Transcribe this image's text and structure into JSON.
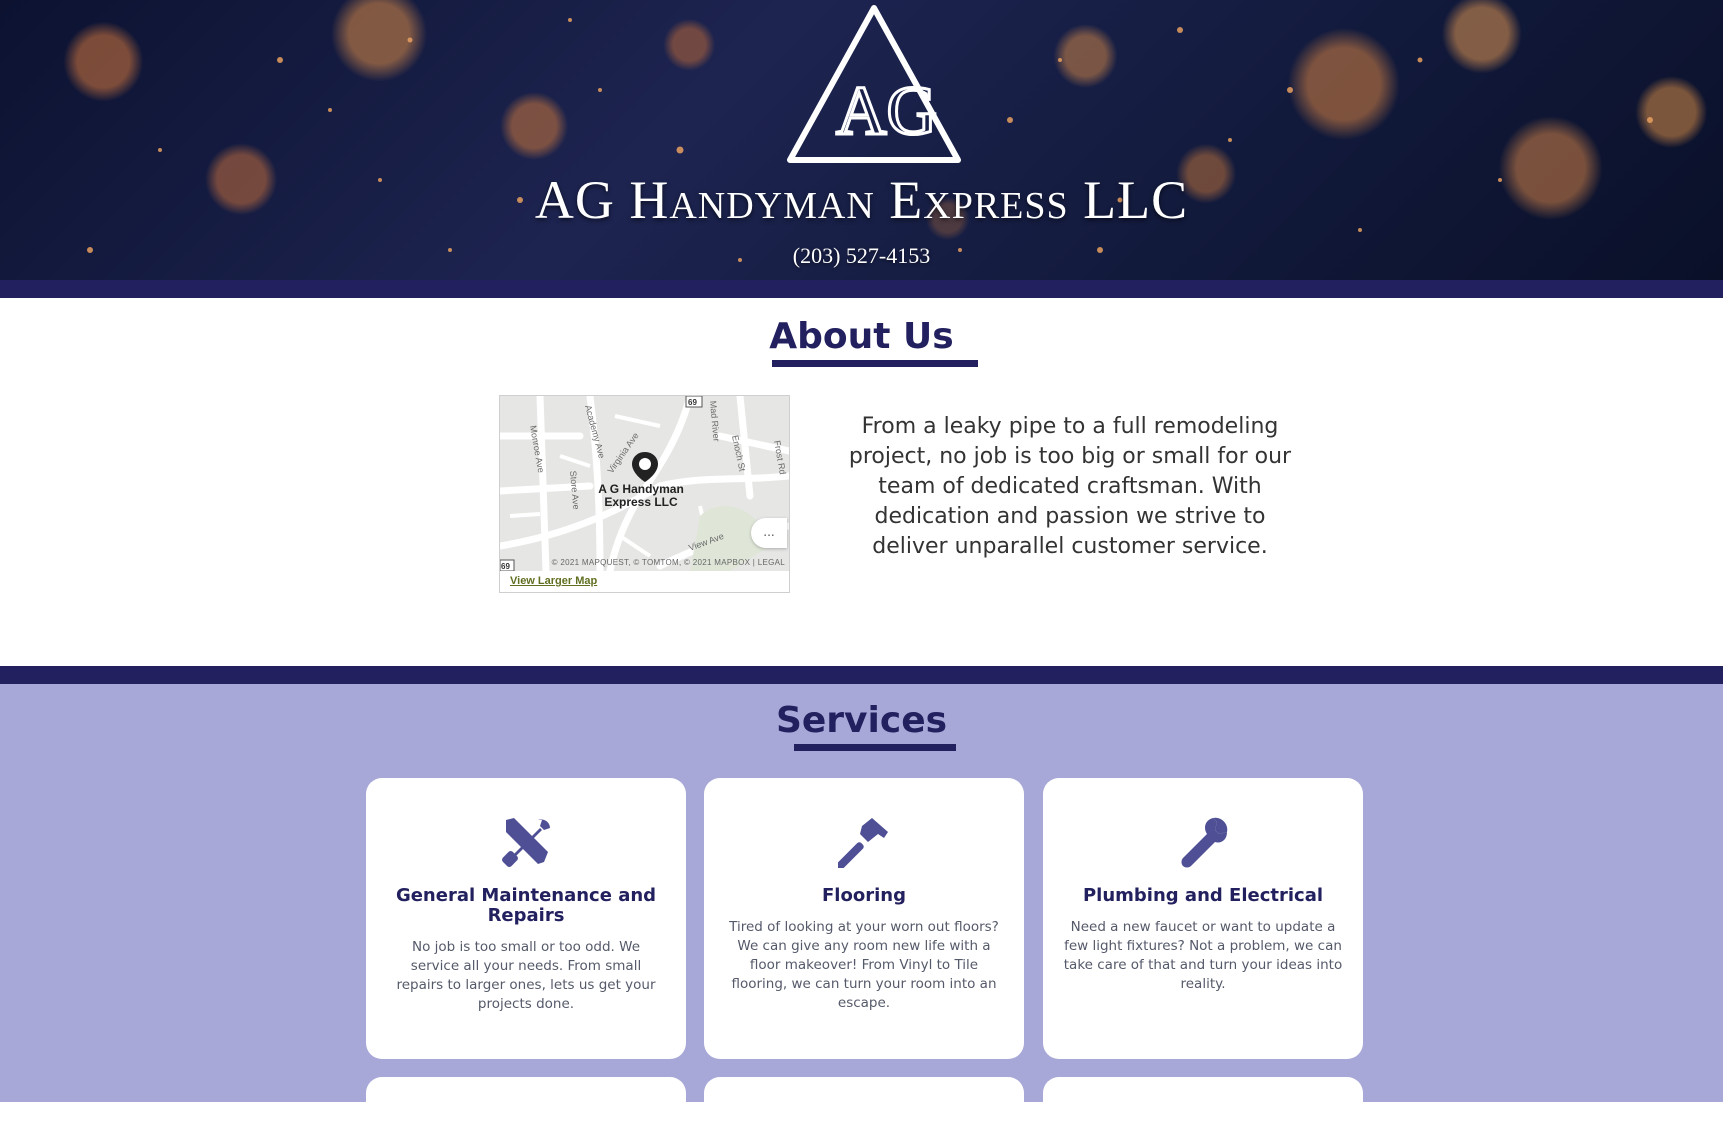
{
  "header": {
    "brand_name": "AG Handyman Express LLC",
    "phone": "(203) 527-4153",
    "logo_letters": "AG",
    "colors": {
      "primary": "#22205e",
      "accent": "#a8a8d8"
    }
  },
  "about": {
    "title": "About Us",
    "text": "From a leaky pipe to a full remodeling project, no job is too big or small for our team of dedicated craftsman. With dedication and passion we strive to deliver unparallel customer service.",
    "map": {
      "business_label": "A G Handyman Express LLC",
      "streets": [
        "Monroe Ave",
        "Academy Ave",
        "Virginia Ave",
        "Store Ave",
        "Enoch St",
        "Frost Rd",
        "Mad River",
        "View Ave"
      ],
      "route_badges": [
        "69",
        "69"
      ],
      "copyright": "© 2021 MAPQUEST, © TOMTOM, © 2021 MAPBOX | LEGAL",
      "more_label": "...",
      "link_label": "View Larger Map",
      "pin_icon": "map-pin-icon"
    }
  },
  "services": {
    "title": "Services",
    "cards": [
      {
        "icon": "tools-icon",
        "title": "General Maintenance and Repairs",
        "text": "No job is too small or too odd. We service all your needs. From small repairs to larger ones, lets us get your projects done."
      },
      {
        "icon": "hammer-icon",
        "title": "Flooring",
        "text": "Tired of looking at your worn out floors? We can give any room new life with a floor makeover! From Vinyl to Tile flooring, we can turn your room into an escape."
      },
      {
        "icon": "wrench-icon",
        "title": "Plumbing and Electrical",
        "text": "Need a new faucet or want to update a few light fixtures? Not a problem, we can take care of that and turn your ideas into reality."
      }
    ]
  }
}
